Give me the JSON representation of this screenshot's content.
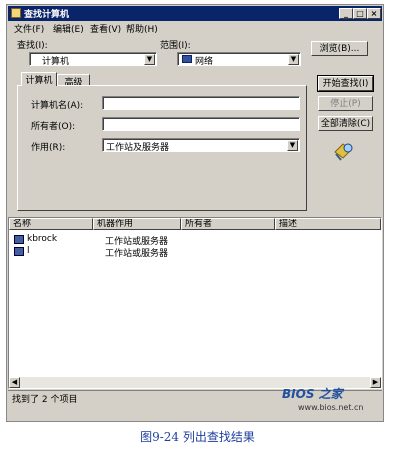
{
  "window": {
    "title": "查找计算机",
    "controls": [
      "_",
      "□",
      "×"
    ]
  },
  "menu": [
    "文件(F)",
    "编辑(E)",
    "查看(V)",
    "帮助(H)"
  ],
  "search": {
    "find_label": "查找(I):",
    "find_value": "计算机",
    "scope_label": "范围(I):",
    "scope_value": "网络",
    "browse_button": "浏览(B)..."
  },
  "tabs": [
    "计算机",
    "高级"
  ],
  "fields": {
    "name_label": "计算机名(A):",
    "name_value": "",
    "owner_label": "所有者(O):",
    "owner_value": "",
    "role_label": "作用(R):",
    "role_value": "工作站及服务器"
  },
  "actions": {
    "find_now": "开始查找(I)",
    "stop": "停止(P)",
    "clear_all": "全部清除(C)"
  },
  "results": {
    "columns": [
      "名称",
      "机器作用",
      "所有者",
      "描述"
    ],
    "rows": [
      {
        "name": "kbrock",
        "role": "工作站或服务器",
        "owner": "",
        "desc": ""
      },
      {
        "name": "l",
        "role": "工作站或服务器",
        "owner": "",
        "desc": ""
      }
    ]
  },
  "status": "找到了 2 个项目",
  "watermark": {
    "brand": "BIOS 之家",
    "url": "www.bios.net.cn"
  },
  "caption": "图9-24   列出查找结果",
  "icons": [
    "window-icon",
    "network-icon",
    "search-flashlight-icon",
    "computer-icon"
  ]
}
